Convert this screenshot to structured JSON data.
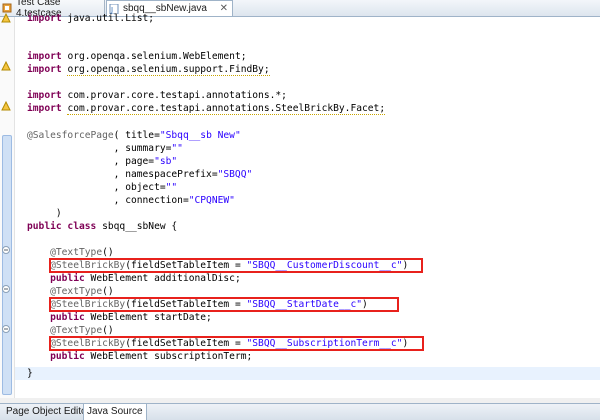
{
  "tabs": [
    {
      "label": "Test Case 4.testcase",
      "active": false
    },
    {
      "label": "sbqq__sbNew.java",
      "active": true,
      "close": "✕"
    }
  ],
  "code": {
    "l1": "List;",
    "l2": "org.openqa.selenium.WebElement;",
    "l3": "org.openqa.selenium.support.FindBy;",
    "l4": "com.provar.core.testapi.annotations.*;",
    "l5": "com.provar.core.testapi.annotations.SteelBrickBy.Facet;",
    "title": "\"Sbqq__sb New\"",
    "summary": "\"\"",
    "page": "\"sb\"",
    "nsprefix": "\"SBQQ\"",
    "object": "\"\"",
    "connection": "\"CPQNEW\"",
    "classname": " sbqq__sbNew ",
    "f1": "\"SBQQ__CustomerDiscount__c\"",
    "d1": " WebElement additionalDisc;",
    "f2": "\"SBQQ__StartDate__c\"",
    "d2": " WebElement startDate;",
    "f3": "\"SBQQ__SubscriptionTerm__c\"",
    "d3": " WebElement subscriptionTerm;"
  },
  "bottom_tabs": [
    {
      "label": "Page Object Editor",
      "active": false
    },
    {
      "label": "Java Source",
      "active": true
    }
  ],
  "colors": {
    "highlight": "#e8211c",
    "keyword": "#7f0055",
    "string": "#2a00ff",
    "annotation": "#646464"
  }
}
